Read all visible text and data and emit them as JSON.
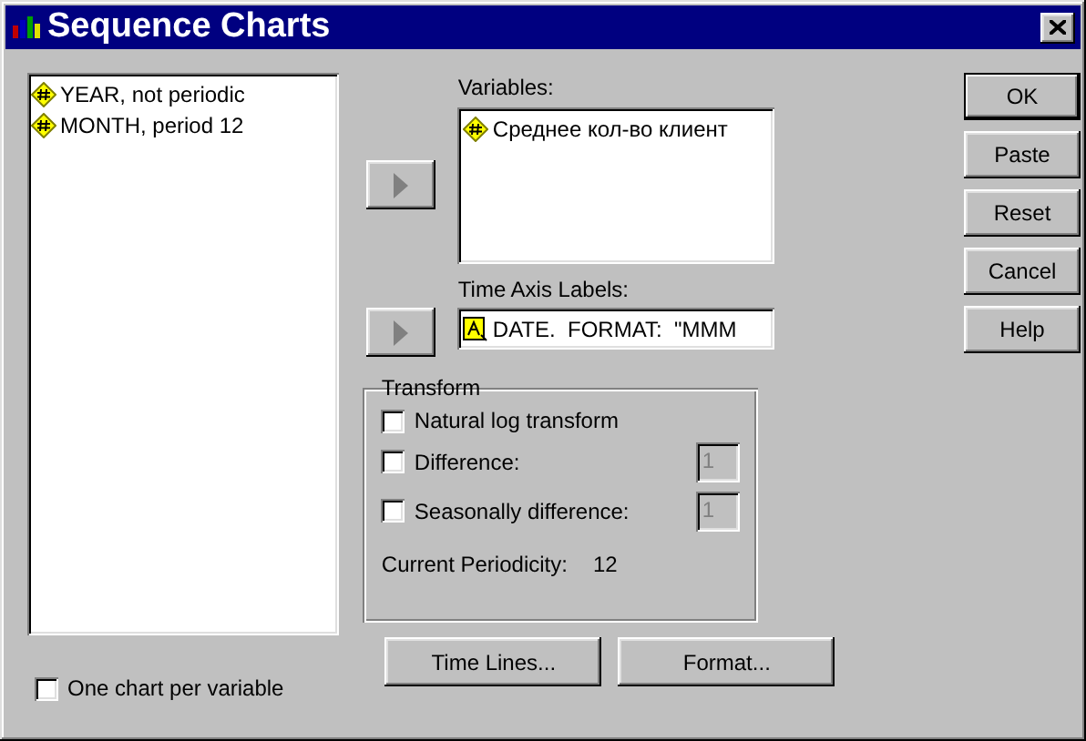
{
  "window": {
    "title": "Sequence Charts"
  },
  "source_list": {
    "items": [
      {
        "label": "YEAR, not periodic",
        "kind": "numeric"
      },
      {
        "label": "MONTH, period 12",
        "kind": "numeric"
      }
    ]
  },
  "variables": {
    "label": "Variables:",
    "items": [
      {
        "label": "Среднее кол-во клиент",
        "kind": "numeric"
      }
    ]
  },
  "time_axis_labels": {
    "label": "Time Axis Labels:",
    "value": "DATE.  FORMAT:  \"MMM",
    "kind": "string"
  },
  "transform": {
    "title": "Transform",
    "options": [
      {
        "label": "Natural log transform",
        "checked": false
      },
      {
        "label": "Difference:",
        "checked": false,
        "value": "1",
        "disabled": true
      },
      {
        "label": "Seasonally difference:",
        "checked": false,
        "value": "1",
        "disabled": true
      }
    ],
    "periodicity_label": "Current Periodicity:",
    "periodicity_value": "12"
  },
  "buttons": [
    {
      "label": "OK",
      "default": true
    },
    {
      "label": "Paste",
      "default": false
    },
    {
      "label": "Reset",
      "default": false
    },
    {
      "label": "Cancel",
      "default": false
    },
    {
      "label": "Help",
      "default": false
    }
  ],
  "bottom_buttons": [
    "Time Lines...",
    "Format..."
  ],
  "one_chart_per_variable": {
    "label": "One chart per variable",
    "checked": false
  }
}
